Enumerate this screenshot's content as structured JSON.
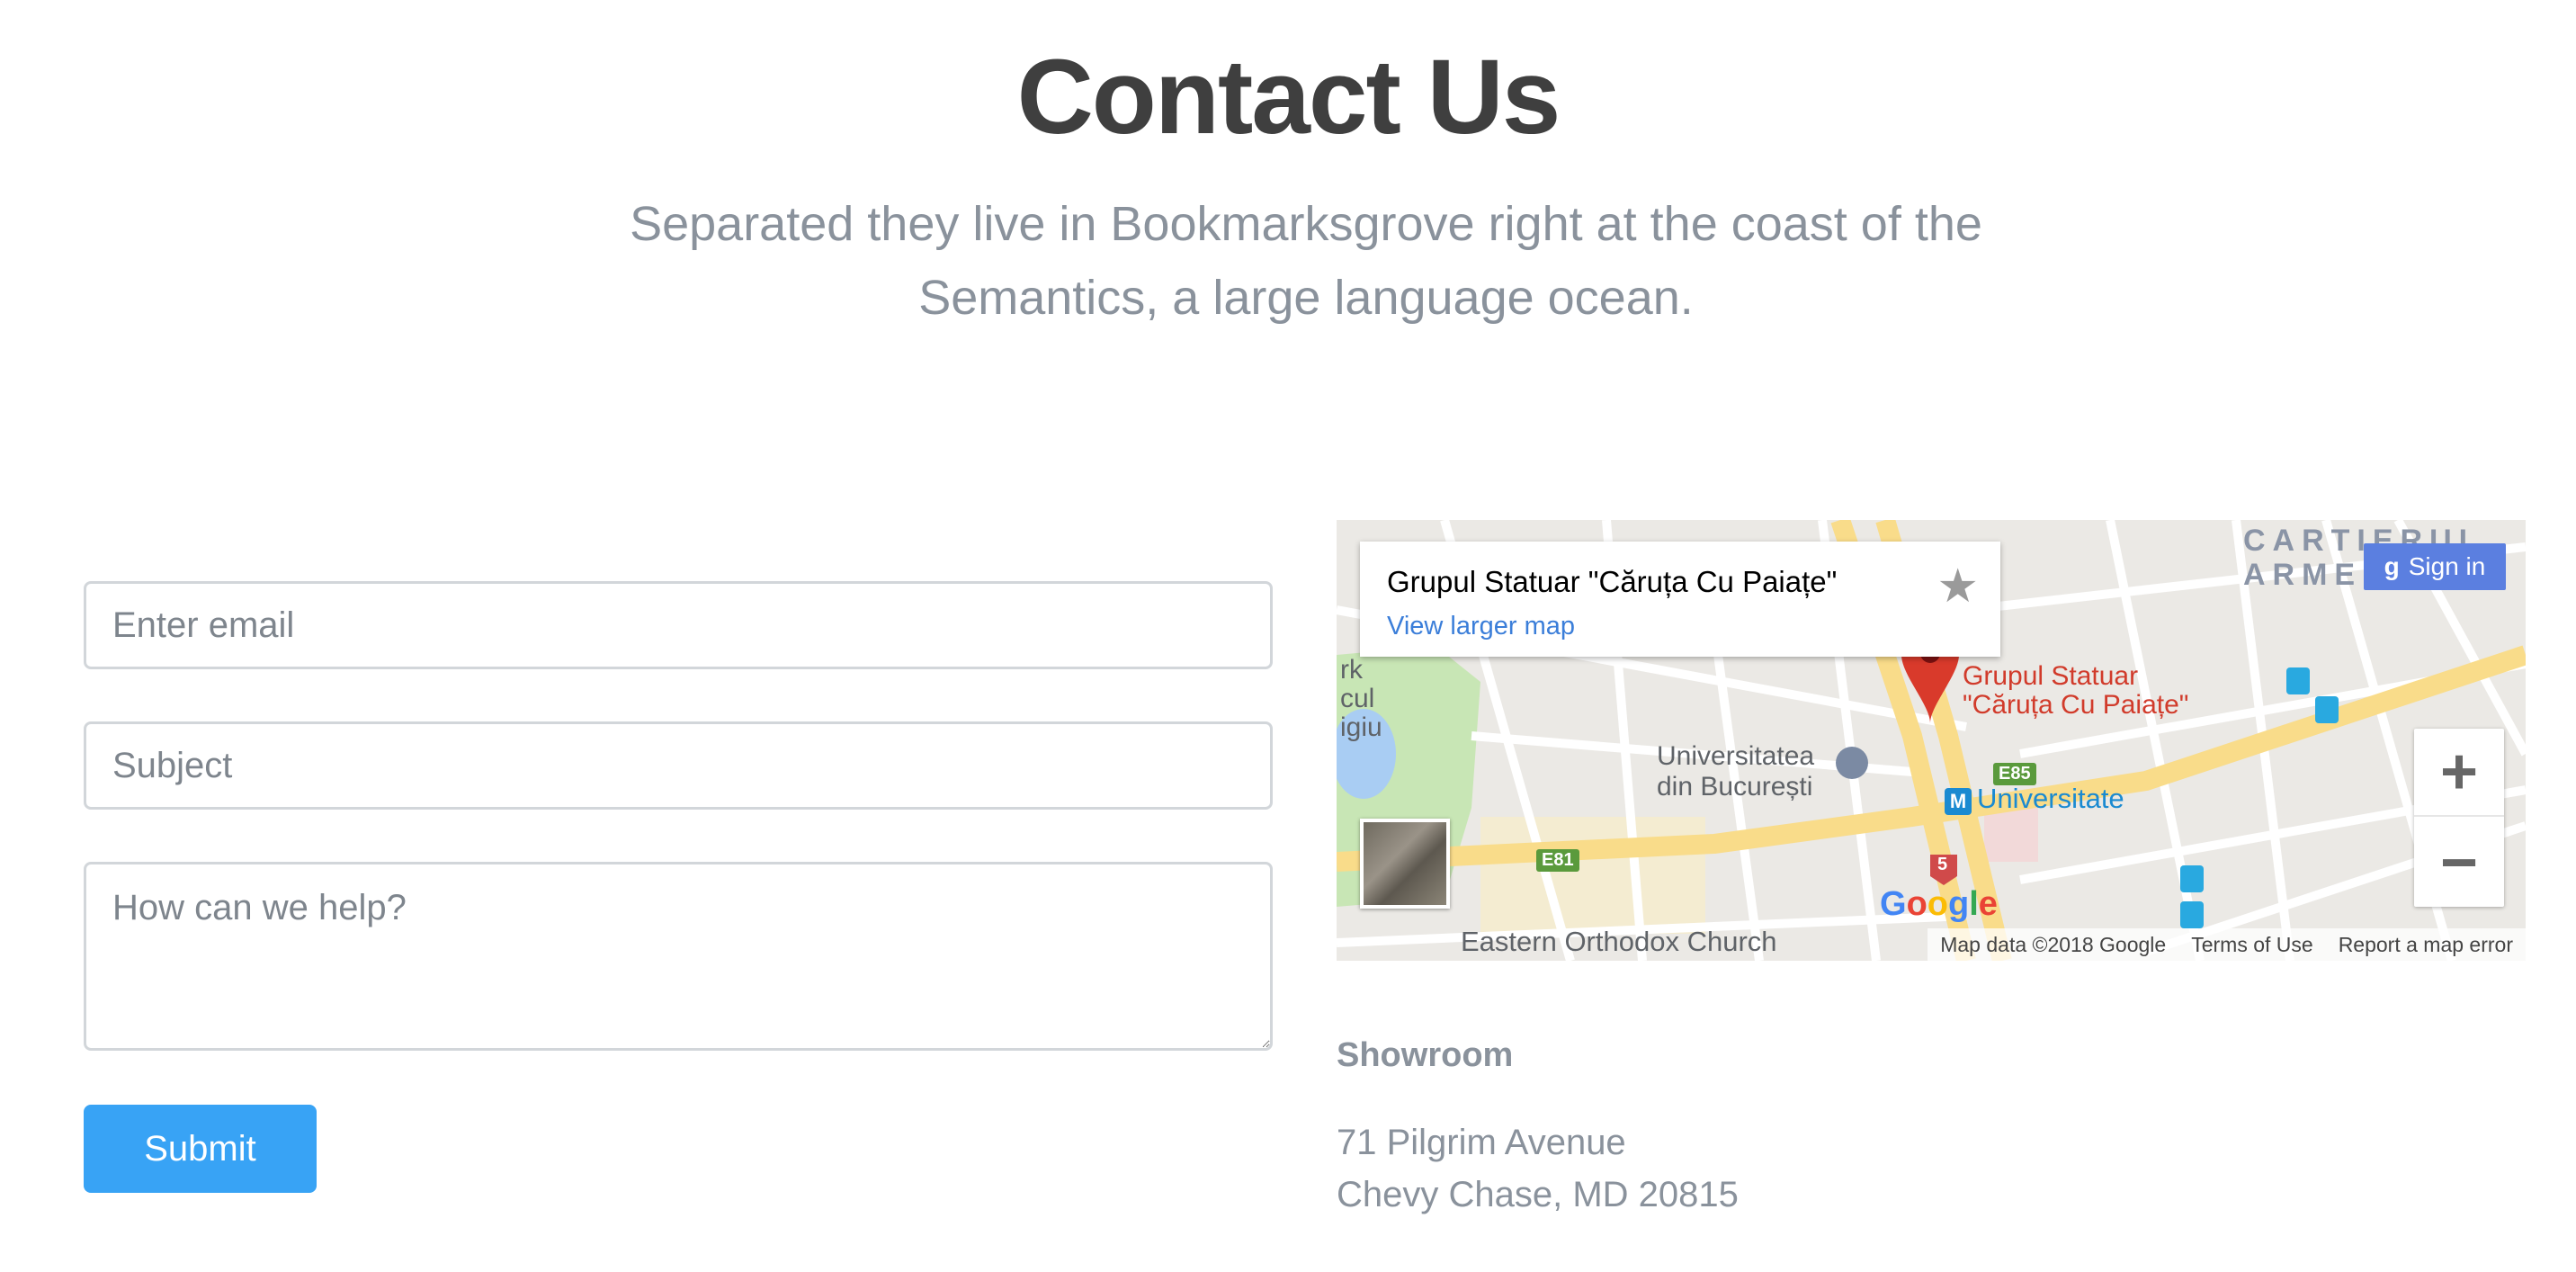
{
  "header": {
    "title": "Contact Us",
    "subtitle": "Separated they live in Bookmarksgrove right at the coast of the Semantics, a large language ocean."
  },
  "form": {
    "email_placeholder": "Enter email",
    "subject_placeholder": "Subject",
    "message_placeholder": "How can we help?",
    "submit_label": "Submit"
  },
  "map": {
    "place_name": "Grupul Statuar \"Căruța Cu Paiațe\"",
    "view_larger": "View larger map",
    "sign_in": "Sign in",
    "district": "CARTIERUL ARME",
    "pin_label_1": "Grupul Statuar",
    "pin_label_2": "\"Căruța Cu Paiațe\"",
    "university_1": "Universitatea",
    "university_2": "din București",
    "metro": "Universitate",
    "church": "Eastern Orthodox Church",
    "road_e85": "E85",
    "road_e81": "E81",
    "road_5": "5",
    "park_1": "rk",
    "park_2": "cul",
    "park_3": "igiu",
    "google": "Google",
    "map_data": "Map data ©2018 Google",
    "terms": "Terms of Use",
    "report": "Report a map error",
    "zoom_in": "+",
    "zoom_out": "−",
    "colors": {
      "pin": "#d93a2b",
      "signin_bg": "#5b7fe0",
      "major_road": "#f9dc8a"
    }
  },
  "showroom": {
    "title": "Showroom",
    "address_line1": "71 Pilgrim Avenue",
    "address_line2": "Chevy Chase, MD 20815"
  },
  "colors": {
    "submit_bg": "#38a3f5",
    "title": "#3f3f3f",
    "muted_text": "#8a929c"
  }
}
